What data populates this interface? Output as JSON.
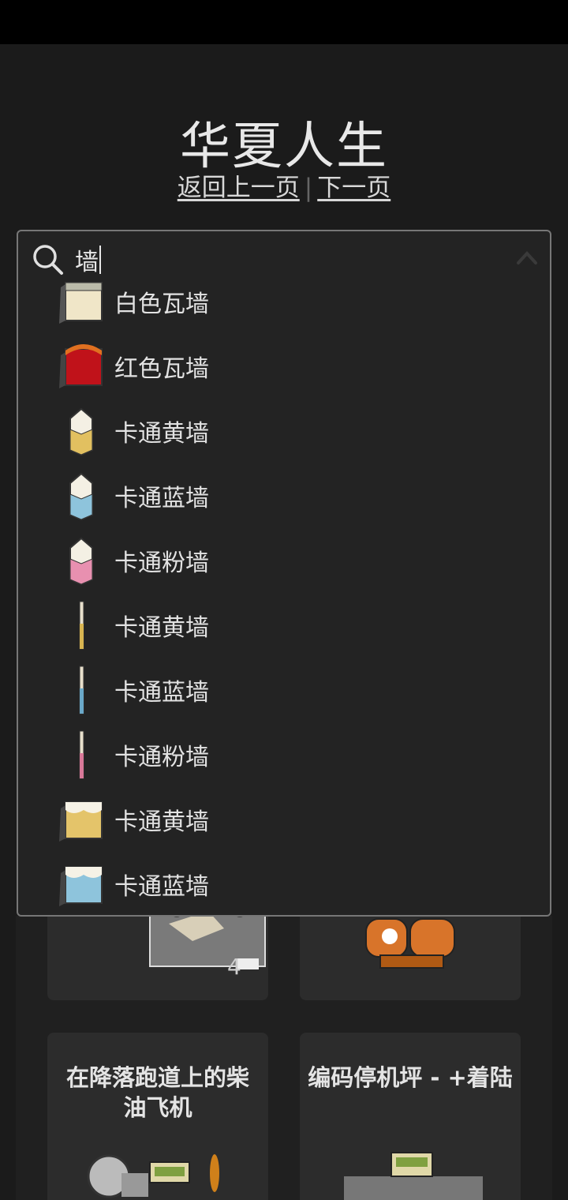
{
  "page": {
    "title": "华夏人生"
  },
  "nav": {
    "back": "返回上一页",
    "separator": "|",
    "next": "下一页"
  },
  "search": {
    "query": "墙"
  },
  "results": [
    {
      "label": "白色瓦墙",
      "icon": "white-tile-wall-icon"
    },
    {
      "label": "红色瓦墙",
      "icon": "red-tile-wall-icon"
    },
    {
      "label": "卡通黄墙",
      "icon": "cartoon-yellow-wall-icon"
    },
    {
      "label": "卡通蓝墙",
      "icon": "cartoon-blue-wall-icon"
    },
    {
      "label": "卡通粉墙",
      "icon": "cartoon-pink-wall-icon"
    },
    {
      "label": "卡通黄墙",
      "icon": "cartoon-yellow-post-icon"
    },
    {
      "label": "卡通蓝墙",
      "icon": "cartoon-blue-post-icon"
    },
    {
      "label": "卡通粉墙",
      "icon": "cartoon-pink-post-icon"
    },
    {
      "label": "卡通黄墙",
      "icon": "cartoon-yellow-block-icon"
    },
    {
      "label": "卡通蓝墙",
      "icon": "cartoon-blue-block-icon"
    }
  ],
  "cards": [
    {
      "title": "",
      "count": "4"
    },
    {
      "title": "",
      "count": ""
    },
    {
      "title": "在降落跑道上的柴油飞机",
      "count": ""
    },
    {
      "title": "编码停机坪 - +着陆",
      "count": ""
    }
  ],
  "colors": {
    "background": "#1b1b1b",
    "dropdown": "#232323",
    "border": "#777777",
    "card": "#2c2c2c"
  }
}
